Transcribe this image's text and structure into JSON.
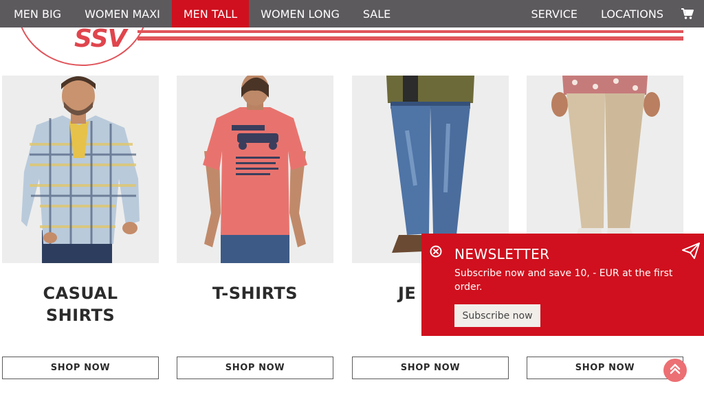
{
  "nav": {
    "items": [
      {
        "label": "MEN BIG",
        "active": false
      },
      {
        "label": "WOMEN MAXI",
        "active": false
      },
      {
        "label": "MEN TALL",
        "active": true
      },
      {
        "label": "WOMEN LONG",
        "active": false
      },
      {
        "label": "SALE",
        "active": false
      }
    ],
    "right_items": [
      "SERVICE",
      "LOCATIONS"
    ],
    "cart_icon": "shopping-cart-icon"
  },
  "brand": {
    "logo_text": "SSV",
    "accent_color": "#d0101e"
  },
  "products": [
    {
      "title_line1": "CASUAL",
      "title_line2": "SHIRTS",
      "button": "SHOP NOW"
    },
    {
      "title_line1": "T-SHIRTS",
      "title_line2": "",
      "button": "SHOP NOW"
    },
    {
      "title_line1": "JE",
      "title_line2": "",
      "button": "SHOP NOW"
    },
    {
      "title_line1": "",
      "title_line2": "",
      "button": "SHOP NOW"
    }
  ],
  "newsletter": {
    "title": "NEWSLETTER",
    "text": "Subscribe now and save 10, - EUR at the first order.",
    "button": "Subscribe now",
    "close_icon": "close-circle-icon",
    "send_icon": "paper-plane-icon"
  },
  "scroll_top_icon": "chevron-up-icon"
}
